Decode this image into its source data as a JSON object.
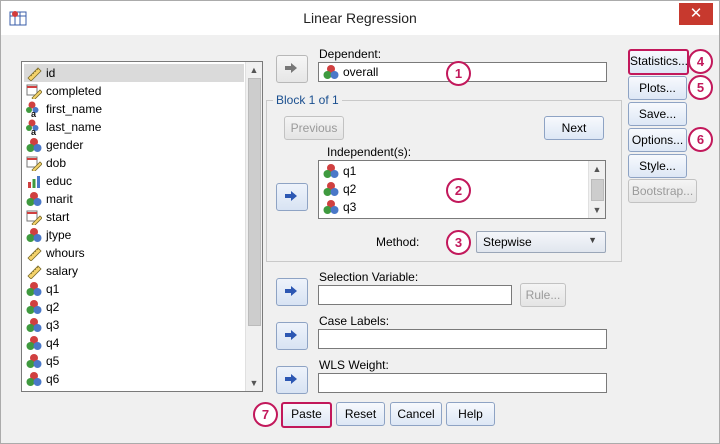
{
  "window": {
    "title": "Linear Regression",
    "close_glyph": "✕"
  },
  "variables": [
    {
      "label": "id",
      "icon": "scale-icon"
    },
    {
      "label": "completed",
      "icon": "date-scale-icon"
    },
    {
      "label": "first_name",
      "icon": "nominal-string-icon"
    },
    {
      "label": "last_name",
      "icon": "nominal-string-icon"
    },
    {
      "label": "gender",
      "icon": "nominal-icon"
    },
    {
      "label": "dob",
      "icon": "date-scale-icon"
    },
    {
      "label": "educ",
      "icon": "ordinal-icon"
    },
    {
      "label": "marit",
      "icon": "nominal-icon"
    },
    {
      "label": "start",
      "icon": "date-scale-icon"
    },
    {
      "label": "jtype",
      "icon": "nominal-icon"
    },
    {
      "label": "whours",
      "icon": "scale-icon"
    },
    {
      "label": "salary",
      "icon": "scale-icon"
    },
    {
      "label": "q1",
      "icon": "nominal-icon"
    },
    {
      "label": "q2",
      "icon": "nominal-icon"
    },
    {
      "label": "q3",
      "icon": "nominal-icon"
    },
    {
      "label": "q4",
      "icon": "nominal-icon"
    },
    {
      "label": "q5",
      "icon": "nominal-icon"
    },
    {
      "label": "q6",
      "icon": "nominal-icon"
    }
  ],
  "selected_variable": "id",
  "dependent": {
    "label": "Dependent:",
    "value": "overall"
  },
  "block": {
    "legend": "Block 1 of 1",
    "previous_label": "Previous",
    "next_label": "Next",
    "independents_label": "Independent(s):",
    "independents": [
      "q1",
      "q2",
      "q3"
    ],
    "method_label": "Method:",
    "method_value": "Stepwise"
  },
  "selection_variable": {
    "label": "Selection Variable:",
    "value": "",
    "rule_label": "Rule..."
  },
  "case_labels": {
    "label": "Case Labels:",
    "value": ""
  },
  "wls_weight": {
    "label": "WLS Weight:",
    "value": ""
  },
  "side_buttons": {
    "statistics": "Statistics...",
    "plots": "Plots...",
    "save": "Save...",
    "options": "Options...",
    "style": "Style...",
    "bootstrap": "Bootstrap..."
  },
  "bottom_buttons": {
    "paste": "Paste",
    "reset": "Reset",
    "cancel": "Cancel",
    "help": "Help"
  },
  "badges": [
    "1",
    "2",
    "3",
    "4",
    "5",
    "6",
    "7"
  ],
  "colors": {
    "badge": "#c2185b",
    "close": "#c7392e"
  }
}
